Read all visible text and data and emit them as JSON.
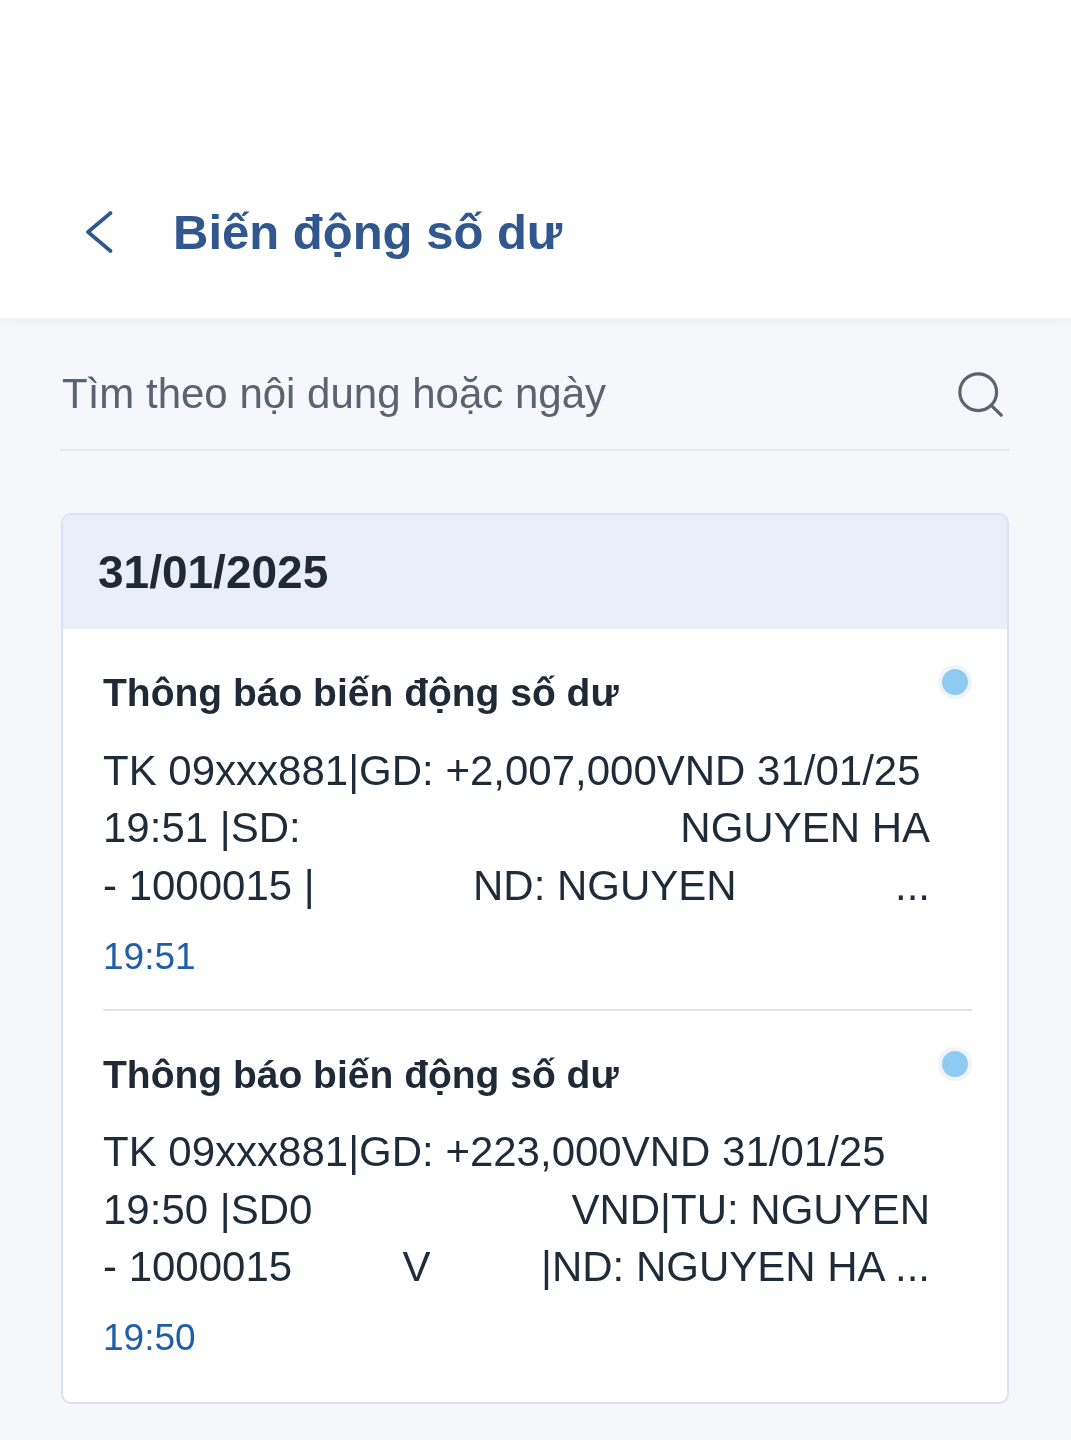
{
  "header": {
    "title": "Biến động số dư"
  },
  "search": {
    "placeholder": "Tìm theo nội dung hoặc ngày"
  },
  "groups": [
    {
      "date": "31/01/2025",
      "notifications": [
        {
          "title": "Thông báo biến động số dư",
          "unread": true,
          "message_lines": [
            [
              "TK 09xxx881|GD: +2,007,000VND 31/01/25"
            ],
            [
              "19:51 |SD:",
              "NGUYEN HA"
            ],
            [
              "- 1000015 |",
              "ND: NGUYEN",
              "..."
            ]
          ],
          "time": "19:51"
        },
        {
          "title": "Thông báo biến động số dư",
          "unread": true,
          "message_lines": [
            [
              "TK 09xxx881|GD: +223,000VND 31/01/25"
            ],
            [
              "19:50 |SD0",
              "VND|TU: NGUYEN"
            ],
            [
              "- 1000015",
              "V",
              "|ND: NGUYEN HA ..."
            ]
          ],
          "time": "19:50"
        }
      ]
    }
  ]
}
